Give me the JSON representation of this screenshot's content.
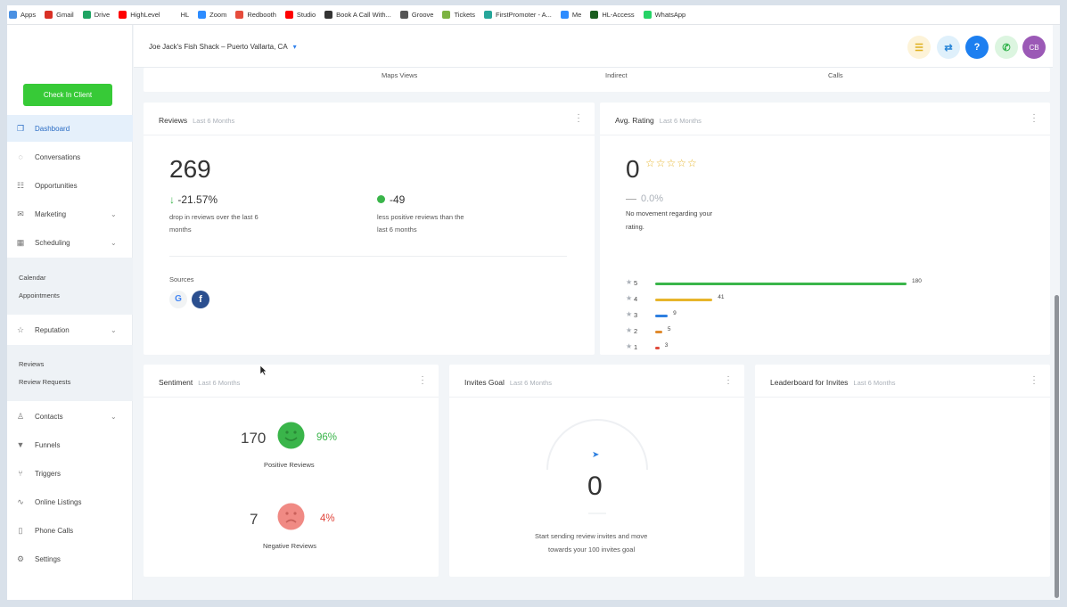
{
  "bookmarks": [
    {
      "label": "Apps",
      "color": "#4a90e2"
    },
    {
      "label": "Gmail",
      "color": "#d93025"
    },
    {
      "label": "Drive",
      "color": "#1fa463"
    },
    {
      "label": "HighLevel",
      "color": "#ff0000"
    },
    {
      "label": "HL",
      "color": "#ffffff"
    },
    {
      "label": "Zoom",
      "color": "#2d8cff"
    },
    {
      "label": "Redbooth",
      "color": "#e64c3c"
    },
    {
      "label": "Studio",
      "color": "#ff0000"
    },
    {
      "label": "Book A Call With...",
      "color": "#333333"
    },
    {
      "label": "Groove",
      "color": "#555555"
    },
    {
      "label": "Tickets",
      "color": "#7cb342"
    },
    {
      "label": "FirstPromoter - A...",
      "color": "#26a69a"
    },
    {
      "label": "Me",
      "color": "#2d8cff"
    },
    {
      "label": "HL-Access",
      "color": "#1b5e20"
    },
    {
      "label": "WhatsApp",
      "color": "#25d366"
    }
  ],
  "topbar": {
    "location": "Joe Jack's Fish Shack – Puerto Vallarta, CA",
    "chevron": "▾",
    "buttons": [
      {
        "icon": "list-icon",
        "glyph": "☰",
        "bg": "#fdf3d8",
        "fg": "#e0b020"
      },
      {
        "icon": "swap-icon",
        "glyph": "⇄",
        "bg": "#dff0fb",
        "fg": "#2a86d8"
      },
      {
        "icon": "help-icon",
        "glyph": "?",
        "bg": "#1d7ff0",
        "fg": "#ffffff"
      },
      {
        "icon": "phone-icon",
        "glyph": "✆",
        "bg": "#dcf5e0",
        "fg": "#2fb24a"
      },
      {
        "icon": "avatar",
        "glyph": "CB",
        "bg": "#9b59b6",
        "fg": "#ffffff"
      }
    ]
  },
  "sidebar": {
    "checkin": "Check In Client",
    "items": [
      {
        "label": "Dashboard",
        "icon": "copy-icon",
        "glyph": "❐"
      },
      {
        "label": "Conversations",
        "icon": "chat-icon",
        "glyph": "◌"
      },
      {
        "label": "Opportunities",
        "icon": "pipeline-icon",
        "glyph": "☷"
      },
      {
        "label": "Marketing",
        "icon": "mail-icon",
        "glyph": "✉"
      },
      {
        "label": "Scheduling",
        "icon": "calendar-icon",
        "glyph": "▦"
      },
      {
        "label": "Reputation",
        "icon": "star-icon",
        "glyph": "☆"
      },
      {
        "label": "Contacts",
        "icon": "person-icon",
        "glyph": "♙"
      },
      {
        "label": "Funnels",
        "icon": "funnel-icon",
        "glyph": "▼"
      },
      {
        "label": "Triggers",
        "icon": "branch-icon",
        "glyph": "⑂"
      },
      {
        "label": "Online Listings",
        "icon": "pulse-icon",
        "glyph": "∿"
      },
      {
        "label": "Phone Calls",
        "icon": "phone-icon",
        "glyph": "▯"
      },
      {
        "label": "Settings",
        "icon": "gear-icon",
        "glyph": "⚙"
      }
    ],
    "scheduling_sub": [
      "Calendar",
      "Appointments"
    ],
    "reputation_sub": [
      "Reviews",
      "Review Requests"
    ],
    "caret": "⌄"
  },
  "top_strip": {
    "labels": [
      "Maps Views",
      "Indirect",
      "Calls"
    ]
  },
  "reviews_card": {
    "title": "Reviews",
    "subtitle": "Last 6 Months",
    "total": "269",
    "change_arrow": "↓",
    "change": "-21.57%",
    "change_desc_1": "drop in reviews over the last 6",
    "change_desc_2": "months",
    "positive_delta": "-49",
    "positive_desc_1": "less positive reviews than the",
    "positive_desc_2": "last 6 months",
    "sources_label": "Sources",
    "google_glyph": "G",
    "facebook_glyph": "f"
  },
  "rating_card": {
    "title": "Avg. Rating",
    "subtitle": "Last 6 Months",
    "value": "0",
    "stars": "☆☆☆☆☆",
    "change": "0.0%",
    "desc_1": "No movement regarding your",
    "desc_2": "rating.",
    "star_glyph": "★",
    "rows": [
      {
        "label": "5",
        "count": "180",
        "value": 180,
        "color": "#3ab54a"
      },
      {
        "label": "4",
        "count": "41",
        "value": 41,
        "color": "#e7b52c"
      },
      {
        "label": "3",
        "count": "9",
        "value": 9,
        "color": "#2d7fe0"
      },
      {
        "label": "2",
        "count": "5",
        "value": 5,
        "color": "#e08a2c"
      },
      {
        "label": "1",
        "count": "3",
        "value": 3,
        "color": "#e04a3c"
      }
    ]
  },
  "sentiment_card": {
    "title": "Sentiment",
    "subtitle": "Last 6 Months",
    "positive_count": "170",
    "positive_pct": "96%",
    "positive_label": "Positive Reviews",
    "negative_count": "7",
    "negative_pct": "4%",
    "negative_label": "Negative Reviews",
    "positive_color": "#3ab54a",
    "negative_color": "#f08a84"
  },
  "invites_card": {
    "title": "Invites Goal",
    "subtitle": "Last 6 Months",
    "value": "0",
    "send_glyph": "➤",
    "desc_1": "Start sending review invites and move",
    "desc_2": "towards your 100 invites goal",
    "progress": 0
  },
  "leaderboard_card": {
    "title": "Leaderboard for Invites",
    "subtitle": "Last 6 Months"
  }
}
